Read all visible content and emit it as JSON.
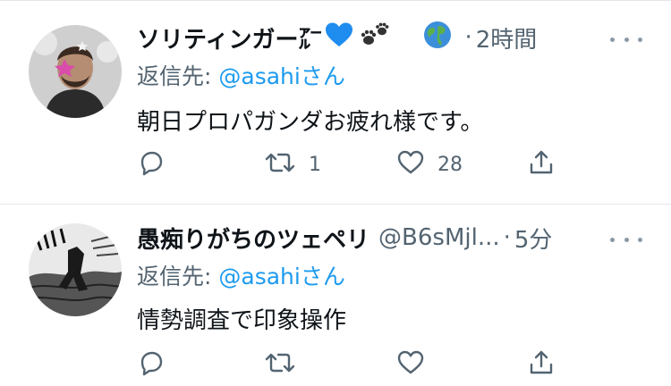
{
  "tweets": [
    {
      "author_name": "ソリティンガー㌃",
      "badges": [
        "blue-heart",
        "paw-prints",
        "globe"
      ],
      "handle": "",
      "dot": "·",
      "time": "2時間",
      "reply_prefix": "返信先: ",
      "reply_mention": "@asahi",
      "reply_suffix": "さん",
      "text": "朝日プロパガンダお疲れ様です。",
      "actions": {
        "replies": "",
        "retweets": "1",
        "likes": "28"
      }
    },
    {
      "author_name": "愚痴りがちのツェペリ",
      "badges": [],
      "handle": "@B6sMjl...",
      "dot": "·",
      "time": "5分",
      "reply_prefix": "返信先: ",
      "reply_mention": "@asahi",
      "reply_suffix": "さん",
      "text": "情勢調査で印象操作",
      "actions": {
        "replies": "",
        "retweets": "",
        "likes": ""
      }
    }
  ],
  "colors": {
    "accent": "#1d9bf0",
    "muted": "#536471",
    "divider": "#e3e6e9"
  },
  "icons": [
    "reply-icon",
    "retweet-icon",
    "like-icon",
    "share-icon",
    "more-icon"
  ]
}
